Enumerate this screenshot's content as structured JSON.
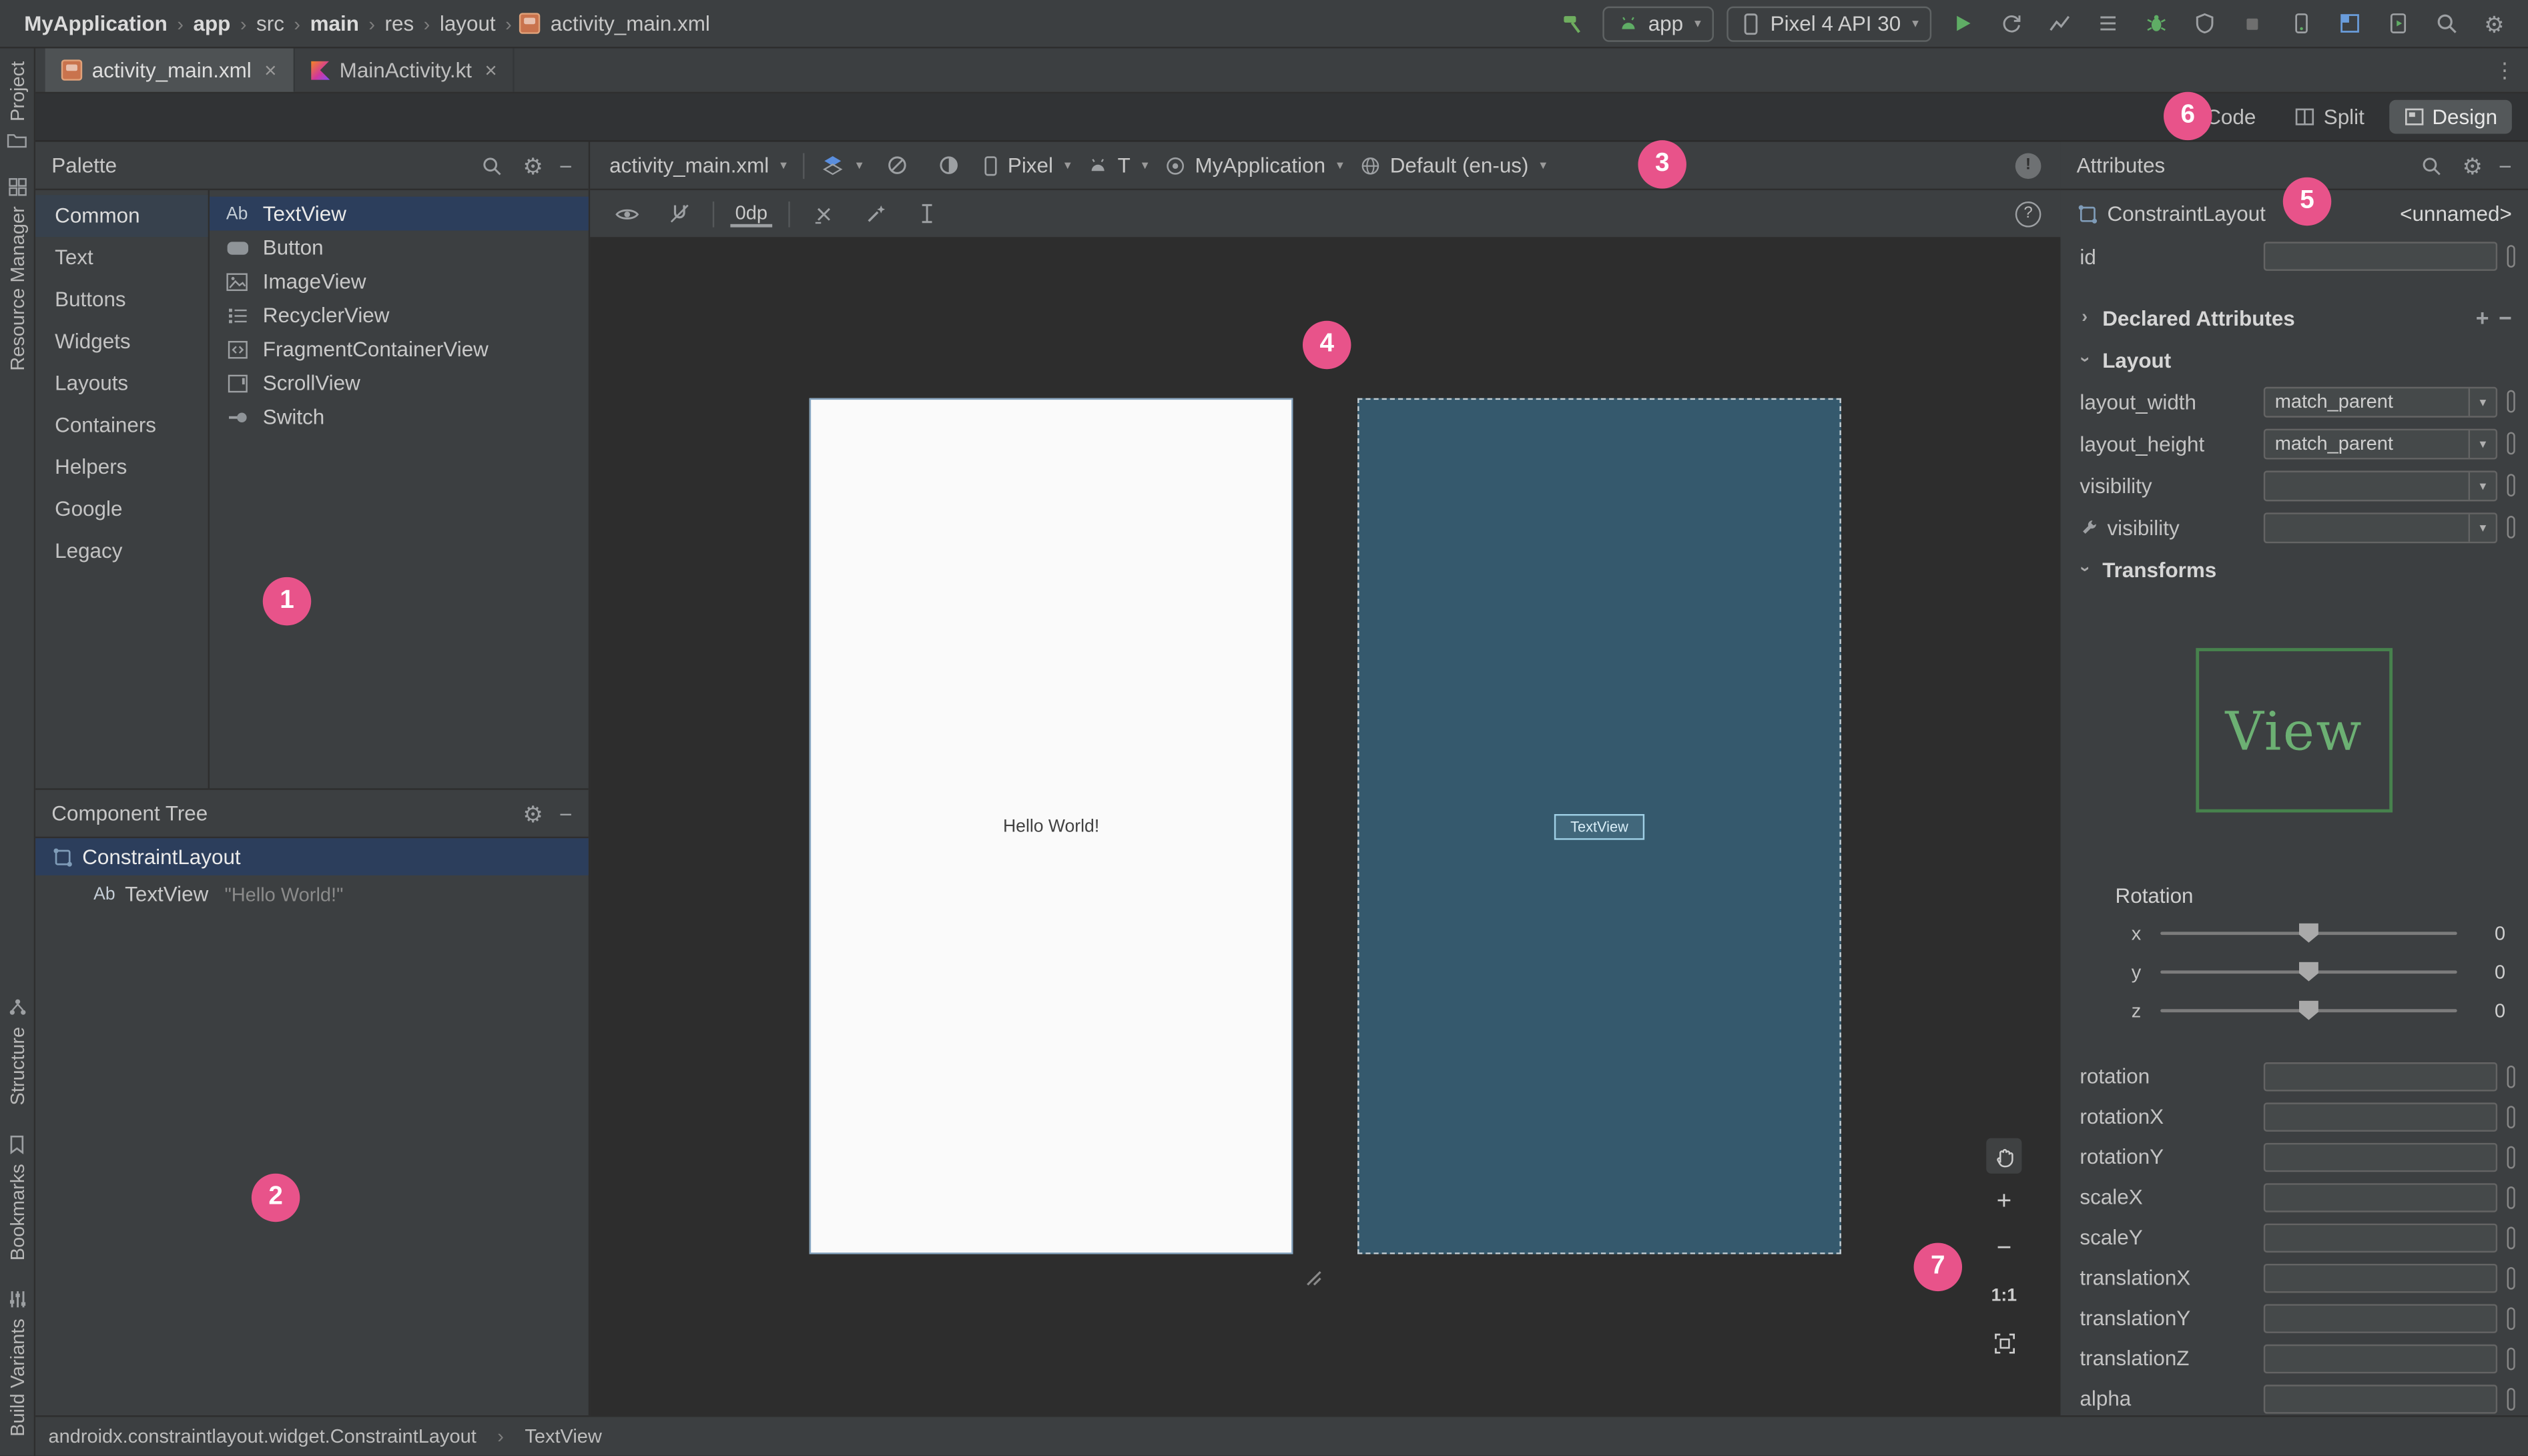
{
  "topbar": {
    "breadcrumbs": [
      "MyApplication",
      "app",
      "src",
      "main",
      "res",
      "layout",
      "activity_main.xml"
    ],
    "run_config_label": "app",
    "device_label": "Pixel 4 API 30"
  },
  "icons": {
    "crumb_sep": "›",
    "dropdown": "▾",
    "close": "×",
    "gear": "⚙",
    "minus": "−",
    "plus": "+",
    "chevron": "›",
    "help": "?",
    "issues": "!",
    "more": "⋮"
  },
  "tabs": {
    "tab1": "activity_main.xml",
    "tab2": "MainActivity.kt"
  },
  "mode_bar": {
    "code": "Code",
    "split": "Split",
    "design": "Design"
  },
  "tool_strip": {
    "project": "Project",
    "resource_manager": "Resource Manager",
    "structure": "Structure",
    "bookmarks": "Bookmarks",
    "build_variants": "Build Variants"
  },
  "palette": {
    "title": "Palette",
    "categories": [
      "Common",
      "Text",
      "Buttons",
      "Widgets",
      "Layouts",
      "Containers",
      "Helpers",
      "Google",
      "Legacy"
    ],
    "items": [
      "TextView",
      "Button",
      "ImageView",
      "RecyclerView",
      "FragmentContainerView",
      "ScrollView",
      "Switch"
    ],
    "textview_icon": "Ab"
  },
  "component_tree": {
    "title": "Component Tree",
    "root": "ConstraintLayout",
    "child": "TextView",
    "child_icon": "Ab",
    "child_value": "\"Hello World!\""
  },
  "design_toolbar": {
    "file": "activity_main.xml",
    "device": "Pixel",
    "api": "T",
    "theme": "MyApplication",
    "locale": "Default (en-us)",
    "margin": "0dp"
  },
  "canvas": {
    "hello_text": "Hello World!",
    "blueprint_widget": "TextView",
    "zoom_one": "1:1"
  },
  "attributes": {
    "title": "Attributes",
    "component": "ConstraintLayout",
    "component_id": "<unnamed>",
    "id_label": "id",
    "declared_section": "Declared Attributes",
    "layout_section": "Layout",
    "transforms_section": "Transforms",
    "rows": [
      {
        "label": "layout_width",
        "value": "match_parent"
      },
      {
        "label": "layout_height",
        "value": "match_parent"
      },
      {
        "label": "visibility",
        "value": ""
      },
      {
        "label": "visibility",
        "value": ""
      }
    ],
    "view_preview": "View",
    "rotation_title": "Rotation",
    "sliders": [
      {
        "axis": "x",
        "value": "0"
      },
      {
        "axis": "y",
        "value": "0"
      },
      {
        "axis": "z",
        "value": "0"
      }
    ],
    "fields": [
      "rotation",
      "rotationX",
      "rotationY",
      "scaleX",
      "scaleY",
      "translationX",
      "translationY",
      "translationZ",
      "alpha"
    ]
  },
  "status_bar": {
    "class_path": "androidx.constraintlayout.widget.ConstraintLayout",
    "selected": "TextView"
  },
  "badges": [
    "1",
    "2",
    "3",
    "4",
    "5",
    "6",
    "7"
  ]
}
